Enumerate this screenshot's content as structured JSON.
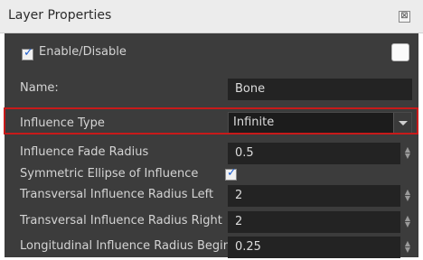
{
  "window": {
    "title": "Layer Properties",
    "close_glyph": "⊠"
  },
  "enable": {
    "label": "Enable/Disable",
    "checked": true
  },
  "name": {
    "label": "Name:",
    "value": "Bone"
  },
  "influence_type": {
    "label": "Influence Type",
    "value": "Infinite"
  },
  "fade_radius": {
    "label": "Influence Fade Radius",
    "value": "0.5"
  },
  "symmetric": {
    "label": "Symmetric Ellipse of Influence",
    "checked": true
  },
  "trans_left": {
    "label": "Transversal Influence Radius Left",
    "value": "2"
  },
  "trans_right": {
    "label": "Transversal Influence Radius Right",
    "value": "2"
  },
  "long_begin": {
    "label": "Longitudinal Influence Radius Begin",
    "value": "0.25"
  },
  "glyphs": {
    "check": "✓",
    "spin_up": "▲",
    "spin_down": "▼"
  },
  "colors": {
    "panel": "#3c3c3c",
    "field": "#232323",
    "highlight": "#c81a1a",
    "check": "#1f5fd0"
  }
}
